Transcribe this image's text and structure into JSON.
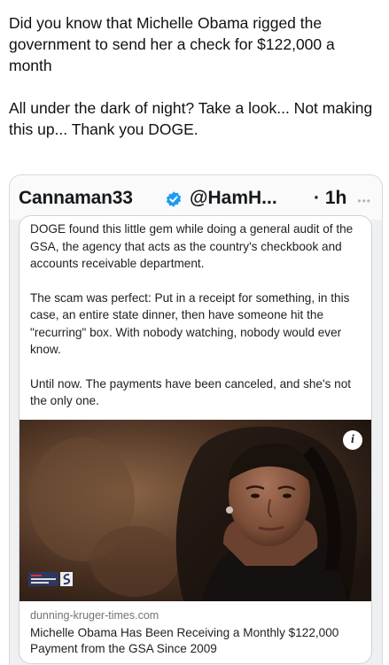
{
  "post": {
    "paragraphs": [
      "Did you know that Michelle Obama rigged the government to send her a check for $122,000 a month",
      "All under the dark of night? Take a look... Not making this up... Thank you DOGE."
    ]
  },
  "embedded_post": {
    "display_name": "Cannaman33",
    "handle": "@HamH...",
    "time": "· 1h",
    "more_icon": "more-dots-icon",
    "verified_icon": "verified-badge-icon",
    "verified_color": "#1d9bf0",
    "paragraphs": [
      "DOGE found this little gem while doing a general audit of the GSA, the agency that acts as the country's checkbook and accounts receivable department.",
      "The scam was perfect: Put in a receipt for something, in this case, an entire state dinner, then have someone hit the \"recurring\" box. With nobody watching, nobody would ever know.",
      "Until now. The payments have been canceled, and she's not the only one."
    ],
    "link_card": {
      "info_icon": "info-icon",
      "info_glyph": "i",
      "domain": "dunning-kruger-times.com",
      "title": "Michelle Obama Has Been Receiving a Monthly $122,000 Payment from the GSA Since 2009"
    }
  }
}
